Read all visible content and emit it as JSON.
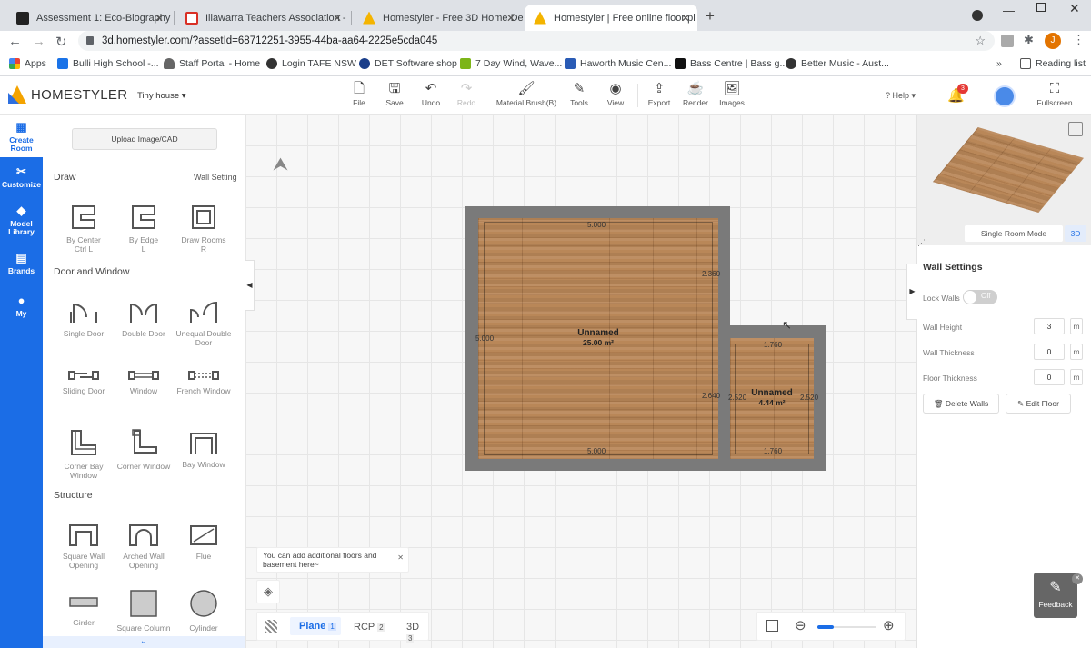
{
  "browser": {
    "tabs": [
      {
        "title": "Assessment 1: Eco-Biography – ",
        "color": "#222"
      },
      {
        "title": "Illawarra Teachers Association - ",
        "color": "#d93025"
      },
      {
        "title": "Homestyler - Free 3D Home De",
        "color": "#f4b400"
      },
      {
        "title": "Homestyler | Free online floor pl",
        "color": "#f4b400"
      }
    ],
    "url": "3d.homestyler.com/?assetId=68712251-3955-44ba-aa64-2225e5cda045",
    "bookmarks": [
      "Apps",
      "Bulli High School -...",
      "Staff Portal - Home",
      "Login TAFE NSW",
      "DET Software shop",
      "7 Day Wind, Wave...",
      "Haworth Music Cen...",
      "Bass Centre | Bass g...",
      "Better Music - Aust..."
    ],
    "reading_list": "Reading list",
    "profile_initial": "J"
  },
  "app": {
    "brand": "HOMESTYLER",
    "project_name": "Tiny house",
    "toolbar": [
      "File",
      "Save",
      "Undo",
      "Redo",
      "Material Brush(B)",
      "Tools",
      "View",
      "Export",
      "Render",
      "Images"
    ],
    "help": "Help",
    "notification_count": "3",
    "fullscreen": "Fullscreen"
  },
  "leftnav": [
    {
      "label": "Create Room",
      "icon": "create-room-icon"
    },
    {
      "label": "Customize",
      "icon": "customize-icon"
    },
    {
      "label": "Model Library",
      "icon": "cube-icon"
    },
    {
      "label": "Brands",
      "icon": "brands-icon"
    },
    {
      "label": "My",
      "icon": "user-icon"
    }
  ],
  "panel": {
    "upload": "Upload Image/CAD",
    "draw_title": "Draw",
    "wall_setting": "Wall Setting",
    "draw_items": [
      {
        "label": "By Center",
        "sub": "Ctrl L"
      },
      {
        "label": "By Edge",
        "sub": "L"
      },
      {
        "label": "Draw Rooms",
        "sub": "R"
      }
    ],
    "door_title": "Door and Window",
    "door_items": [
      "Single Door",
      "Double Door",
      "Unequal Double Door",
      "Sliding Door",
      "Window",
      "French Window",
      "Corner Bay Window",
      "Corner Window",
      "Bay Window"
    ],
    "structure_title": "Structure",
    "structure_items": [
      "Square Wall Opening",
      "Arched Wall Opening",
      "Flue",
      "Girder",
      "Square Column",
      "Cylinder"
    ]
  },
  "canvas": {
    "room1": {
      "name": "Unnamed",
      "area": "25.00 m²",
      "dims": {
        "top": "5.000",
        "bottom": "5.000",
        "left": "5.000",
        "right_top": "2.360",
        "right_mid": "2.640"
      }
    },
    "room2": {
      "name": "Unnamed",
      "area": "4.44 m²",
      "dims": {
        "top": "1.760",
        "bottom": "1.760",
        "left": "2.520",
        "right": "2.520"
      }
    },
    "tip": "You can add additional floors and basement here~",
    "view_tabs": [
      {
        "label": "Plane",
        "num": "1"
      },
      {
        "label": "RCP",
        "num": "2"
      },
      {
        "label": "3D",
        "num": "3"
      }
    ]
  },
  "rightpanel": {
    "mode": "Single Room Mode",
    "mode_3d": "3D",
    "title": "Wall Settings",
    "lock_walls": "Lock Walls",
    "lock_state": "Off",
    "wall_height": {
      "label": "Wall Height",
      "value": "3",
      "unit": "m"
    },
    "wall_thickness": {
      "label": "Wall Thickness",
      "value": "0",
      "unit": "m"
    },
    "floor_thickness": {
      "label": "Floor Thickness",
      "value": "0",
      "unit": "m"
    },
    "delete_walls": "Delete Walls",
    "edit_floor": "Edit Floor",
    "feedback": "Feedback"
  }
}
